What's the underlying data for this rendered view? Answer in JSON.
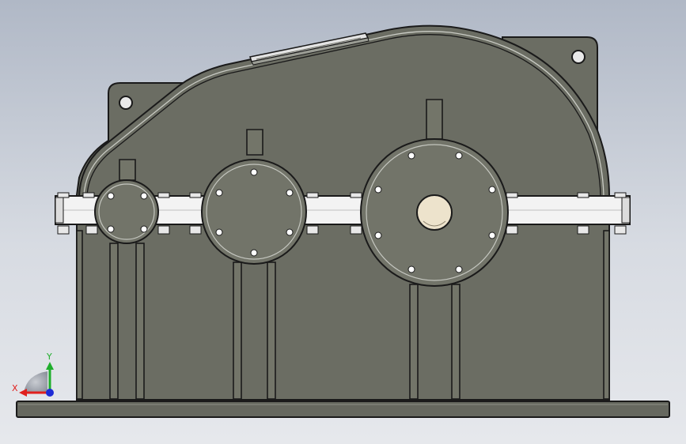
{
  "viewport": {
    "colors": {
      "background_top": "#b0b8c6",
      "background_bottom": "#e6e8ec",
      "housing_fill": "#6b6d63",
      "housing_stroke": "#1a1a1a",
      "flange_fill": "#f3f3f3",
      "boss_fill": "#727469",
      "shaft_fill": "#ede3cc",
      "base_fill": "#66685f"
    }
  },
  "triad": {
    "x_label": "X",
    "y_label": "Y",
    "x_color": "#e0201e",
    "y_color": "#1fae2c",
    "z_color": "#1d2bd6"
  },
  "model": {
    "type": "two-stage gearbox housing, front view",
    "icon": "gearbox-housing-icon"
  }
}
